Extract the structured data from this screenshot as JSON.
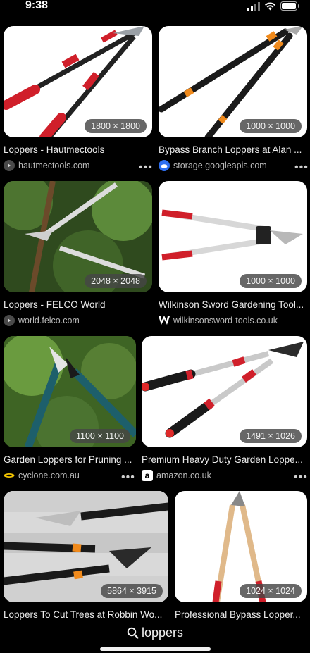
{
  "status_bar": {
    "time": "9:38"
  },
  "results": [
    {
      "title": "Loppers - Hautmectools",
      "source": "hautmectools.com",
      "dims": "1800 × 1800",
      "favicon": "globe-icon"
    },
    {
      "title": "Bypass Branch Loppers at Alan ...",
      "source": "storage.googleapis.com",
      "dims": "1000 × 1000",
      "favicon": "google-cloud-icon"
    },
    {
      "title": "Loppers - FELCO World",
      "source": "world.felco.com",
      "dims": "2048 × 2048",
      "favicon": "globe-icon"
    },
    {
      "title": "Wilkinson Sword Gardening Tool...",
      "source": "wilkinsonsword-tools.co.uk",
      "dims": "1000 × 1000",
      "favicon": "w-logo-icon"
    },
    {
      "title": "Garden Loppers for Pruning ...",
      "source": "cyclone.com.au",
      "dims": "1100 × 1100",
      "favicon": "cyclone-logo-icon"
    },
    {
      "title": "Premium Heavy Duty Garden Loppe...",
      "source": "amazon.co.uk",
      "dims": "1491 × 1026",
      "favicon": "amazon-logo-icon"
    },
    {
      "title": "Loppers To Cut Trees at Robbin Wo...",
      "source": "",
      "dims": "5864 × 3915",
      "favicon": ""
    },
    {
      "title": "Professional Bypass Lopper...",
      "source": "",
      "dims": "1024 × 1024",
      "favicon": ""
    }
  ],
  "more_label": "•••",
  "search": {
    "query": "loppers"
  }
}
